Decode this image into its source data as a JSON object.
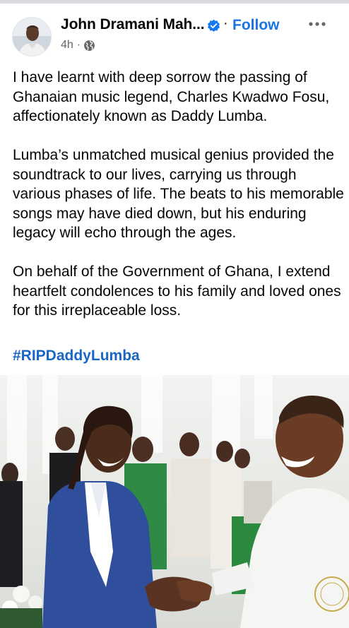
{
  "post": {
    "author": "John Dramani Mah...",
    "follow_label": "Follow",
    "separator": "·",
    "time": "4h",
    "time_separator": "·",
    "paragraphs": [
      [
        "I have learnt with deep sorrow the passing of",
        "Ghanaian music legend, Charles Kwadwo Fosu,",
        "affectionately known as Daddy Lumba."
      ],
      [
        "Lumba’s unmatched musical genius provided the",
        "soundtrack to our lives, carrying us through",
        "various phases of life. The beats to his memorable",
        "songs may have died down, but his enduring",
        "legacy will echo through the ages."
      ],
      [
        "On behalf of the Government of Ghana, I extend",
        "heartfelt condolences to his family and loved ones",
        "for this irreplaceable loss."
      ]
    ],
    "hashtag": "#RIPDaddyLumba"
  },
  "icons": {
    "verified": "verified-badge-icon",
    "more": "more-options-icon",
    "privacy": "globe-icon"
  },
  "colors": {
    "follow": "#1b74e4",
    "hashtag": "#1a66c4",
    "meta": "#65676b",
    "verified": "#1877f2"
  }
}
